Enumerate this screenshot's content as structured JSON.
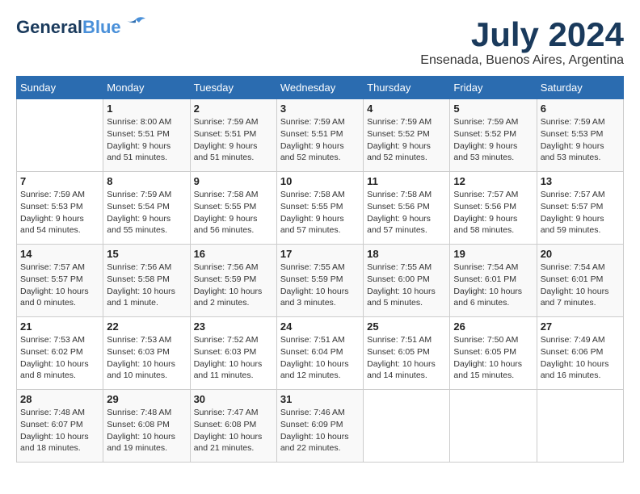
{
  "header": {
    "logo_general": "General",
    "logo_blue": "Blue",
    "month_year": "July 2024",
    "location": "Ensenada, Buenos Aires, Argentina"
  },
  "days_of_week": [
    "Sunday",
    "Monday",
    "Tuesday",
    "Wednesday",
    "Thursday",
    "Friday",
    "Saturday"
  ],
  "weeks": [
    [
      {
        "day": "",
        "info": ""
      },
      {
        "day": "1",
        "info": "Sunrise: 8:00 AM\nSunset: 5:51 PM\nDaylight: 9 hours\nand 51 minutes."
      },
      {
        "day": "2",
        "info": "Sunrise: 7:59 AM\nSunset: 5:51 PM\nDaylight: 9 hours\nand 51 minutes."
      },
      {
        "day": "3",
        "info": "Sunrise: 7:59 AM\nSunset: 5:51 PM\nDaylight: 9 hours\nand 52 minutes."
      },
      {
        "day": "4",
        "info": "Sunrise: 7:59 AM\nSunset: 5:52 PM\nDaylight: 9 hours\nand 52 minutes."
      },
      {
        "day": "5",
        "info": "Sunrise: 7:59 AM\nSunset: 5:52 PM\nDaylight: 9 hours\nand 53 minutes."
      },
      {
        "day": "6",
        "info": "Sunrise: 7:59 AM\nSunset: 5:53 PM\nDaylight: 9 hours\nand 53 minutes."
      }
    ],
    [
      {
        "day": "7",
        "info": "Sunrise: 7:59 AM\nSunset: 5:53 PM\nDaylight: 9 hours\nand 54 minutes."
      },
      {
        "day": "8",
        "info": "Sunrise: 7:59 AM\nSunset: 5:54 PM\nDaylight: 9 hours\nand 55 minutes."
      },
      {
        "day": "9",
        "info": "Sunrise: 7:58 AM\nSunset: 5:55 PM\nDaylight: 9 hours\nand 56 minutes."
      },
      {
        "day": "10",
        "info": "Sunrise: 7:58 AM\nSunset: 5:55 PM\nDaylight: 9 hours\nand 57 minutes."
      },
      {
        "day": "11",
        "info": "Sunrise: 7:58 AM\nSunset: 5:56 PM\nDaylight: 9 hours\nand 57 minutes."
      },
      {
        "day": "12",
        "info": "Sunrise: 7:57 AM\nSunset: 5:56 PM\nDaylight: 9 hours\nand 58 minutes."
      },
      {
        "day": "13",
        "info": "Sunrise: 7:57 AM\nSunset: 5:57 PM\nDaylight: 9 hours\nand 59 minutes."
      }
    ],
    [
      {
        "day": "14",
        "info": "Sunrise: 7:57 AM\nSunset: 5:57 PM\nDaylight: 10 hours\nand 0 minutes."
      },
      {
        "day": "15",
        "info": "Sunrise: 7:56 AM\nSunset: 5:58 PM\nDaylight: 10 hours\nand 1 minute."
      },
      {
        "day": "16",
        "info": "Sunrise: 7:56 AM\nSunset: 5:59 PM\nDaylight: 10 hours\nand 2 minutes."
      },
      {
        "day": "17",
        "info": "Sunrise: 7:55 AM\nSunset: 5:59 PM\nDaylight: 10 hours\nand 3 minutes."
      },
      {
        "day": "18",
        "info": "Sunrise: 7:55 AM\nSunset: 6:00 PM\nDaylight: 10 hours\nand 5 minutes."
      },
      {
        "day": "19",
        "info": "Sunrise: 7:54 AM\nSunset: 6:01 PM\nDaylight: 10 hours\nand 6 minutes."
      },
      {
        "day": "20",
        "info": "Sunrise: 7:54 AM\nSunset: 6:01 PM\nDaylight: 10 hours\nand 7 minutes."
      }
    ],
    [
      {
        "day": "21",
        "info": "Sunrise: 7:53 AM\nSunset: 6:02 PM\nDaylight: 10 hours\nand 8 minutes."
      },
      {
        "day": "22",
        "info": "Sunrise: 7:53 AM\nSunset: 6:03 PM\nDaylight: 10 hours\nand 10 minutes."
      },
      {
        "day": "23",
        "info": "Sunrise: 7:52 AM\nSunset: 6:03 PM\nDaylight: 10 hours\nand 11 minutes."
      },
      {
        "day": "24",
        "info": "Sunrise: 7:51 AM\nSunset: 6:04 PM\nDaylight: 10 hours\nand 12 minutes."
      },
      {
        "day": "25",
        "info": "Sunrise: 7:51 AM\nSunset: 6:05 PM\nDaylight: 10 hours\nand 14 minutes."
      },
      {
        "day": "26",
        "info": "Sunrise: 7:50 AM\nSunset: 6:05 PM\nDaylight: 10 hours\nand 15 minutes."
      },
      {
        "day": "27",
        "info": "Sunrise: 7:49 AM\nSunset: 6:06 PM\nDaylight: 10 hours\nand 16 minutes."
      }
    ],
    [
      {
        "day": "28",
        "info": "Sunrise: 7:48 AM\nSunset: 6:07 PM\nDaylight: 10 hours\nand 18 minutes."
      },
      {
        "day": "29",
        "info": "Sunrise: 7:48 AM\nSunset: 6:08 PM\nDaylight: 10 hours\nand 19 minutes."
      },
      {
        "day": "30",
        "info": "Sunrise: 7:47 AM\nSunset: 6:08 PM\nDaylight: 10 hours\nand 21 minutes."
      },
      {
        "day": "31",
        "info": "Sunrise: 7:46 AM\nSunset: 6:09 PM\nDaylight: 10 hours\nand 22 minutes."
      },
      {
        "day": "",
        "info": ""
      },
      {
        "day": "",
        "info": ""
      },
      {
        "day": "",
        "info": ""
      }
    ]
  ]
}
